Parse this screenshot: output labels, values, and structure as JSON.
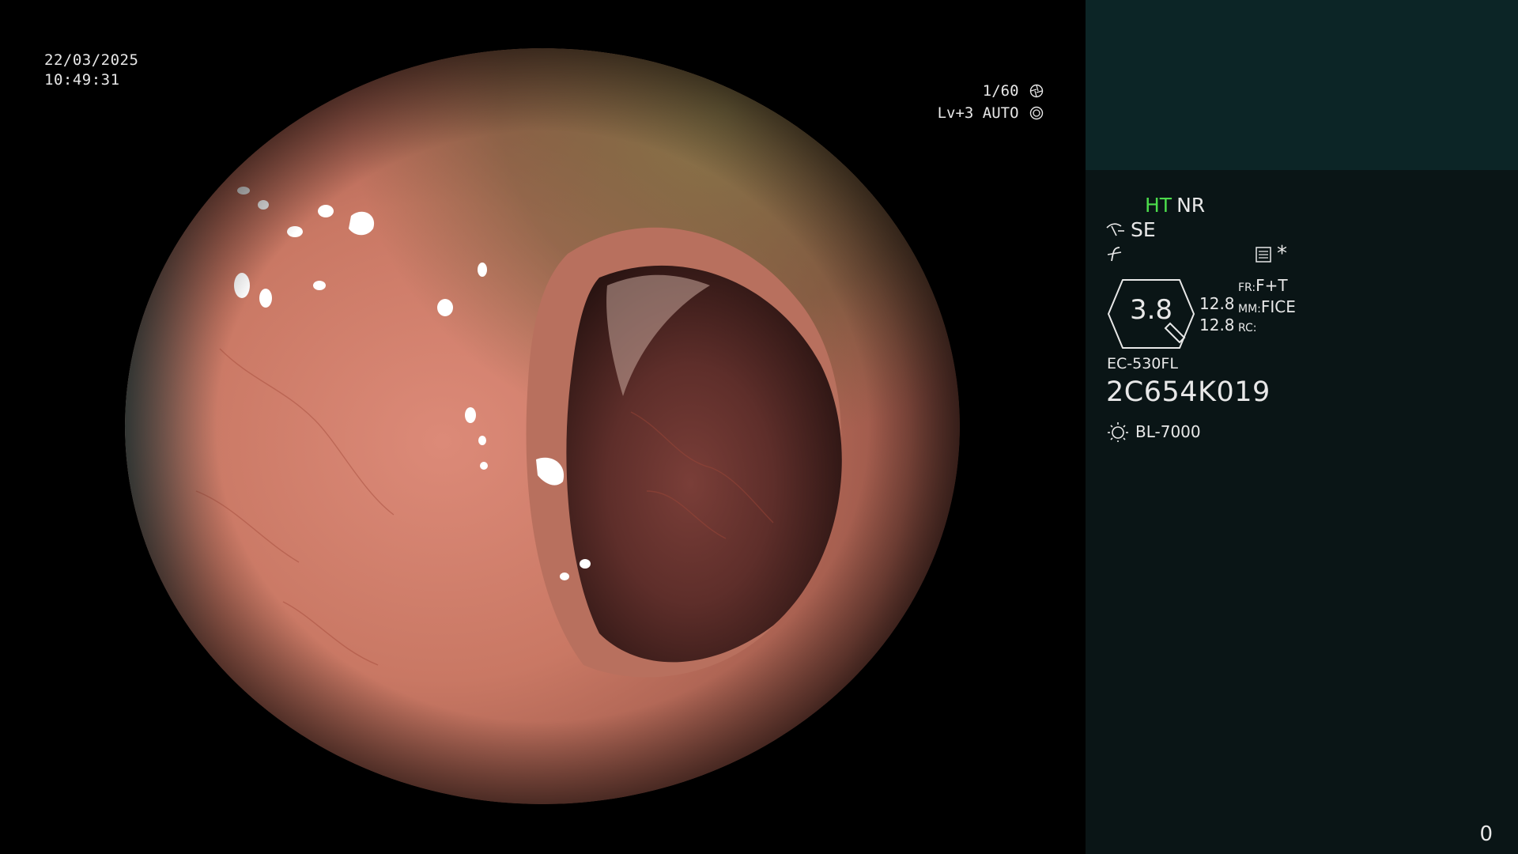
{
  "osd": {
    "date": "22/03/2025",
    "time": "10:49:31",
    "shutter": "1/60",
    "iris_mode": "Lv+3 AUTO"
  },
  "panel": {
    "mode_ht": "HT",
    "mode_nr": "NR",
    "mode_se": "SE",
    "zoom_value": "3.8",
    "value_fr": "12.8",
    "value_mm": "12.8",
    "label_fr": "FR:",
    "label_mm": "MM:",
    "label_rc": "RC:",
    "fr_mode": "F+T",
    "mm_mode": "FICE",
    "scope_model": "EC-530FL",
    "scope_serial": "2C654K019",
    "light_source": "BL-7000",
    "asterisk": "*",
    "counter": "0"
  },
  "colors": {
    "panel_bg": "#0a1516",
    "thumb_bg": "#0c2526",
    "ht_green": "#4cdc4c"
  },
  "icons": [
    "shutter-icon",
    "iris-icon",
    "structure-icon",
    "enhance-icon",
    "memory-icon",
    "light-source-icon"
  ]
}
